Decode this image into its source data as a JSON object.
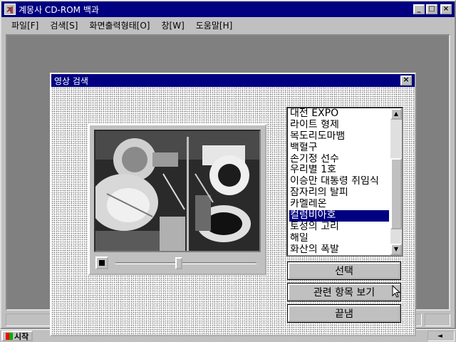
{
  "app": {
    "title": "계몽사 CD-ROM 백과",
    "icon_label": "계",
    "window_buttons": {
      "minimize": "_",
      "maximize": "□",
      "close": "×"
    }
  },
  "menu": [
    {
      "label": "파일[F]"
    },
    {
      "label": "검색[S]"
    },
    {
      "label": "화면출력형태[O]"
    },
    {
      "label": "창[W]"
    },
    {
      "label": "도움말[H]"
    }
  ],
  "dialog": {
    "title": "영상 검색",
    "close_label": "×",
    "video": {
      "playback_position": 0.45,
      "stop_icon": "stop-icon"
    },
    "list": {
      "items": [
        "대전 EXPO",
        "라이트 형제",
        "목도리도마뱀",
        "백혈구",
        "손기정 선수",
        "우리별 1호",
        "이승만 대통령 취임식",
        "잠자리의 탈피",
        "카멜레온",
        "컬럼비아호",
        "토성의 고리",
        "해일",
        "화산의 폭발"
      ],
      "selected_index": 9,
      "scroll_up": "▲",
      "scroll_down": "▼"
    },
    "buttons": {
      "select": "선택",
      "related": "관련 항목 보기",
      "close": "끝냄"
    }
  },
  "taskbar": {
    "start_label": "시작",
    "tray_time": ""
  },
  "colors": {
    "desktop": "#008080",
    "title_bar": "#000080",
    "face": "#c0c0c0",
    "selection": "#000080"
  }
}
